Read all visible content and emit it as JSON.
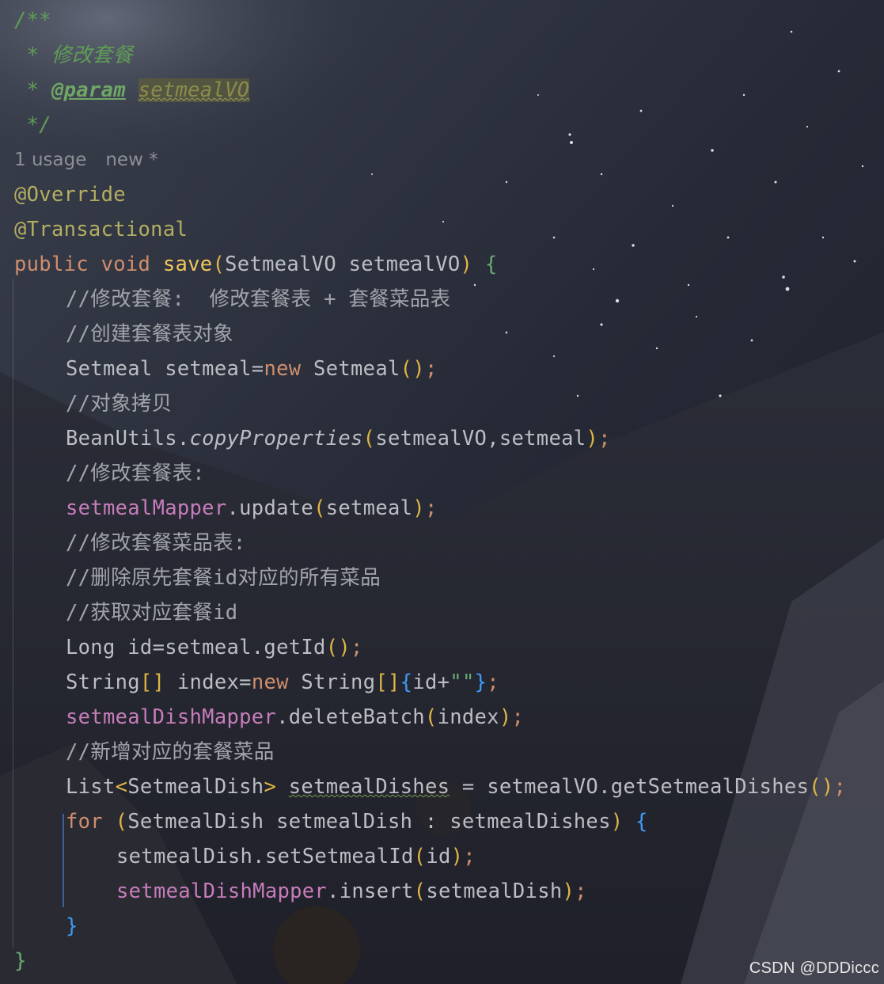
{
  "javadoc": {
    "open": "/**",
    "star1": " * ",
    "description": "修改套餐",
    "star2": " * ",
    "param_tag": "@param",
    "param_name": "setmealVO",
    "close": " */"
  },
  "inlay_hints": {
    "usages": "1 usage",
    "author": "new *"
  },
  "code": {
    "annotation1": "@Override",
    "annotation2": "@Transactional",
    "sig_public": "public",
    "sig_void": "void",
    "sig_name": "save",
    "sig_params": "SetmealVO setmealVO",
    "comment1": "//修改套餐:  修改套餐表 + 套餐菜品表",
    "comment2": "//创建套餐表对象",
    "l_setmeal_decl": "Setmeal setmeal=",
    "kw_new": "new",
    "l_setmeal_ctor": " Setmeal",
    "comment3": "//对象拷贝",
    "l_beanutils": "BeanUtils.",
    "l_copyprops": "copyProperties",
    "l_copy_args": "setmealVO,setmeal",
    "comment4": "//修改套餐表:",
    "f_setmealMapper": "setmealMapper",
    "l_update": ".update",
    "l_update_arg": "setmeal",
    "comment5": "//修改套餐菜品表:",
    "comment6": "//删除原先套餐id对应的所有菜品",
    "comment7": "//获取对应套餐id",
    "l_long": "Long id=setmeal.getId",
    "l_string_type": "String",
    "l_index": " index=",
    "l_string2": " String",
    "l_id_plus": "id+",
    "l_str_lit": "\"\"",
    "f_setmealDishMapper": "setmealDishMapper",
    "l_deletebatch": ".deleteBatch",
    "l_index_arg": "index",
    "comment8": "//新增对应的套餐菜品",
    "l_list": "List",
    "l_list_generic": "SetmealDish",
    "l_dishes_var": "setmealDishes",
    "l_dishes_rhs": " = setmealVO.getSetmealDishes",
    "kw_for": "for",
    "l_for_body": "SetmealDish setmealDish : setmealDishes",
    "l_setsetmealid": "setmealDish.setSetmealId",
    "l_id_arg": "id",
    "l_insert": ".insert",
    "l_insert_arg": "setmealDish"
  },
  "watermark": "CSDN @DDDiccc",
  "colors": {
    "background": "#1e1f24",
    "keyword": "#cf8e6d",
    "method_decl": "#56a8f5",
    "field": "#c77dbb",
    "annotation": "#b3ae60",
    "doc_comment": "#5f9e55",
    "line_comment": "#a2a4ab",
    "default_text": "#bcbec4"
  }
}
